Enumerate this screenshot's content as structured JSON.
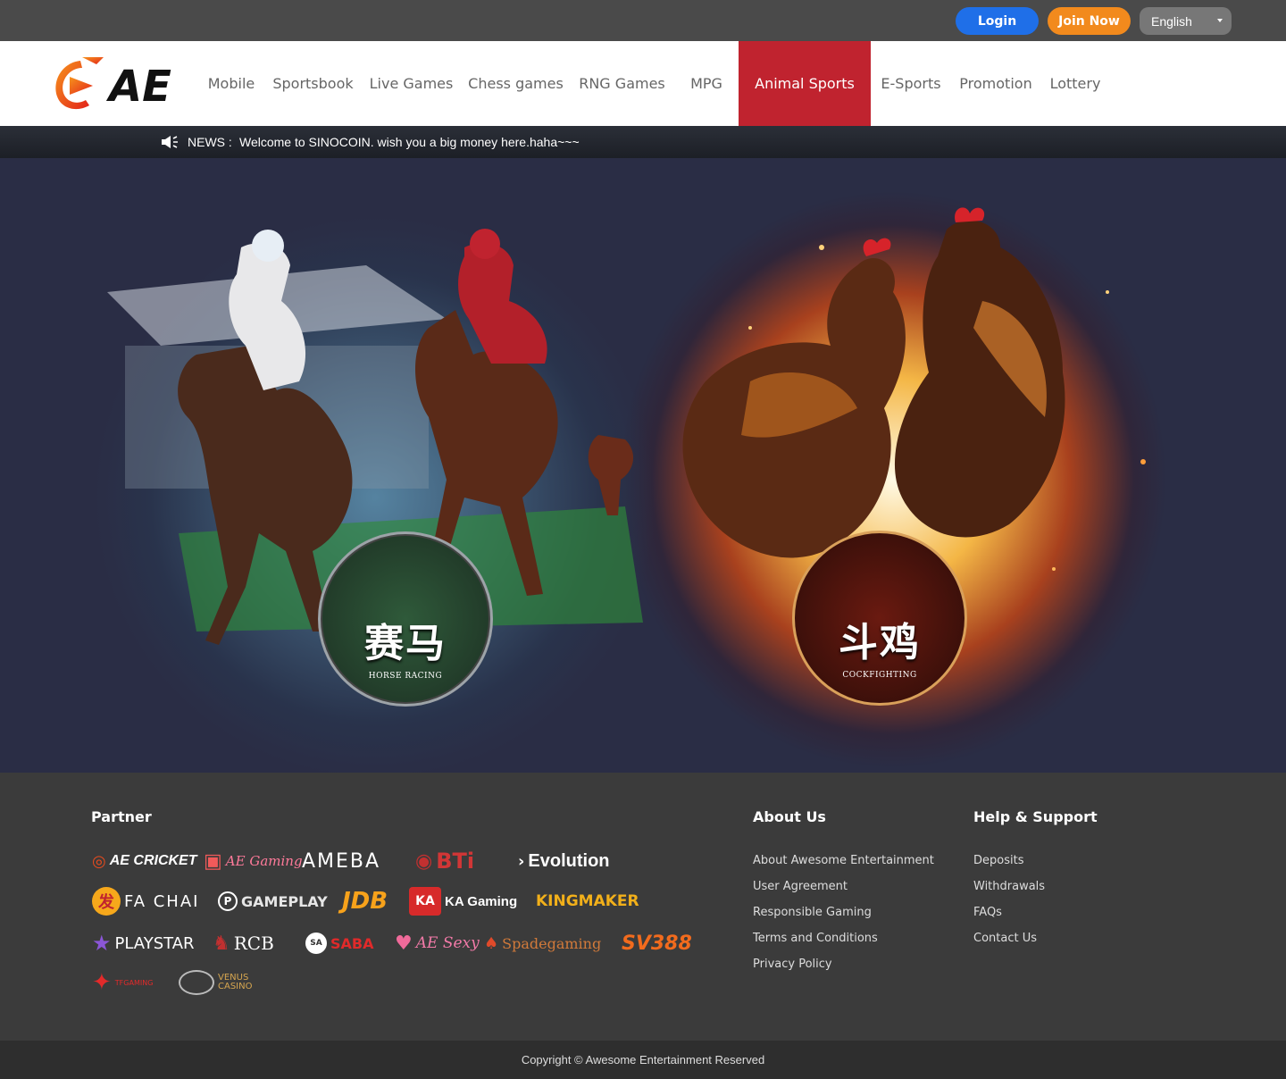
{
  "header": {
    "login_label": "Login",
    "join_label": "Join Now",
    "language": "English"
  },
  "brand": {
    "logo_text": "AE"
  },
  "nav": {
    "items": [
      "Mobile",
      "Sportsbook",
      "Live Games",
      "Chess games",
      "RNG Games",
      "MPG",
      "Animal Sports",
      "E-Sports",
      "Promotion",
      "Lottery"
    ],
    "active": "Animal Sports"
  },
  "news": {
    "label": "NEWS :",
    "text": "Welcome to SINOCOIN. wish you a big money here.haha~~~"
  },
  "hero": {
    "horse_racing": {
      "cn": "赛马",
      "en": "HORSE RACING"
    },
    "cockfighting": {
      "cn": "斗鸡",
      "en": "COCKFIGHTING"
    }
  },
  "footer": {
    "partner_title": "Partner",
    "partners": [
      "AE CRICKET",
      "AE Gaming",
      "AMEBA",
      "BTi",
      "Evolution",
      "FA CHAI",
      "GAMEPLAY",
      "JDB",
      "KA Gaming",
      "KINGMAKER",
      "PLAYSTAR",
      "RCB",
      "SABA",
      "AE Sexy",
      "Spadegaming",
      "SV388",
      "TFGAMING",
      "VENUS CASINO"
    ],
    "about_title": "About Us",
    "about_links": [
      "About Awesome Entertainment",
      "User Agreement",
      "Responsible Gaming",
      "Terms and Conditions",
      "Privacy Policy"
    ],
    "help_title": "Help & Support",
    "help_links": [
      "Deposits",
      "Withdrawals",
      "FAQs",
      "Contact Us"
    ],
    "copyright": "Copyright © Awesome Entertainment Reserved"
  },
  "colors": {
    "login": "#1f6fe8",
    "join": "#f28a1d",
    "nav_active": "#c0232f",
    "logo_orange": "#f05a1e"
  }
}
